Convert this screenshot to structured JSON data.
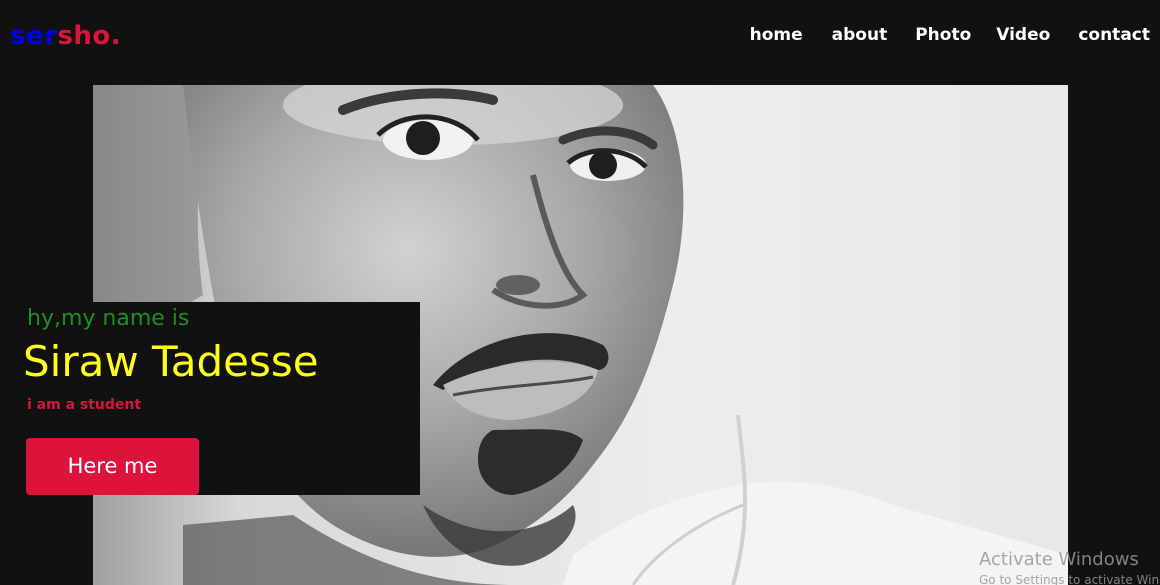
{
  "logo": {
    "part_a": "ser",
    "part_b": "sho."
  },
  "nav": {
    "items": [
      {
        "label": "home"
      },
      {
        "label": "about"
      },
      {
        "label": "Photo"
      },
      {
        "label": "Video"
      },
      {
        "label": "contact"
      }
    ]
  },
  "hero": {
    "greeting": "hy,my name is",
    "name": "Siraw Tadesse",
    "role": "i am a student",
    "button_label": "Here me"
  },
  "watermark": {
    "title": "Activate Windows",
    "subtitle": "Go to Settings to activate Windows."
  },
  "colors": {
    "background": "#111111",
    "logo_primary": "#0000ee",
    "logo_accent": "#dc143c",
    "greeting": "#1f8f1f",
    "name": "#ffff1a",
    "role": "#dc143c",
    "button": "#dc143c"
  }
}
